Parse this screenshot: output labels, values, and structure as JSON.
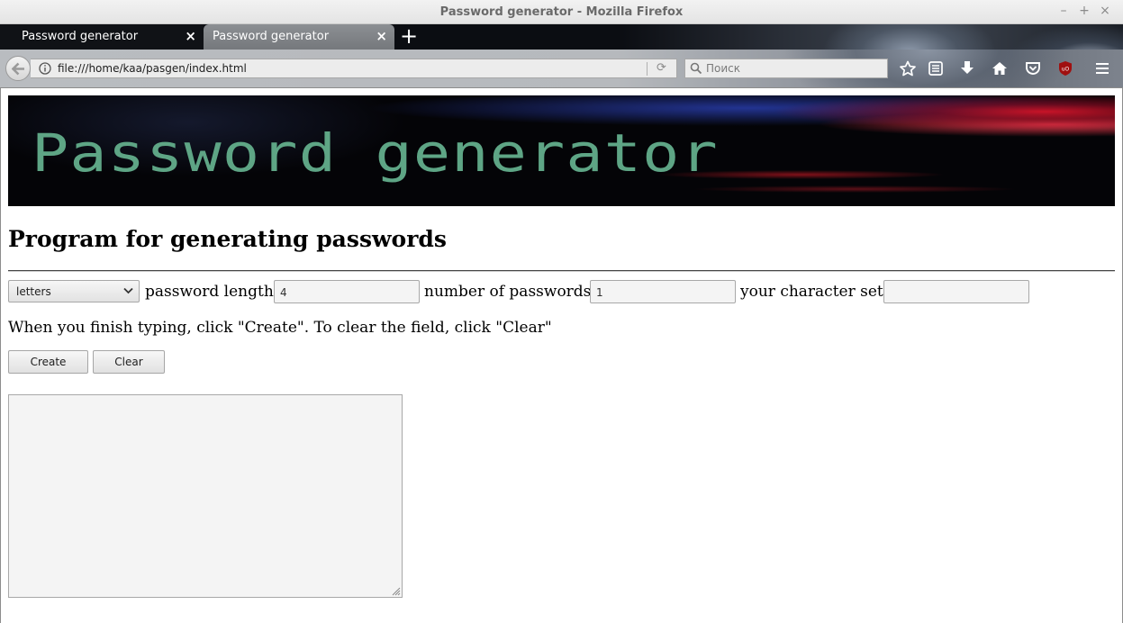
{
  "window": {
    "title": "Password generator - Mozilla Firefox",
    "minimize": "–",
    "maximize": "+",
    "close": "×"
  },
  "tabs": [
    {
      "label": "Password generator",
      "close": "×"
    },
    {
      "label": "Password generator",
      "close": "×"
    }
  ],
  "new_tab": "+",
  "navbar": {
    "url": "file:///home/kaa/pasgen/index.html",
    "search_placeholder": "Поиск",
    "reload_glyph": "⟳"
  },
  "page": {
    "banner_title": "Password generator",
    "heading": "Program for generating passwords",
    "select_value": "letters",
    "length_label": "password length:",
    "length_value": "4",
    "count_label": "number of passwords:",
    "count_value": "1",
    "charset_label": "your character set:",
    "charset_value": "",
    "instructions": "When you finish typing, click \"Create\". To clear the field, click \"Clear\"",
    "create_label": "Create",
    "clear_label": "Clear",
    "output_value": ""
  },
  "colors": {
    "banner_text": "#5ea585",
    "ublock_red": "#a01010"
  }
}
